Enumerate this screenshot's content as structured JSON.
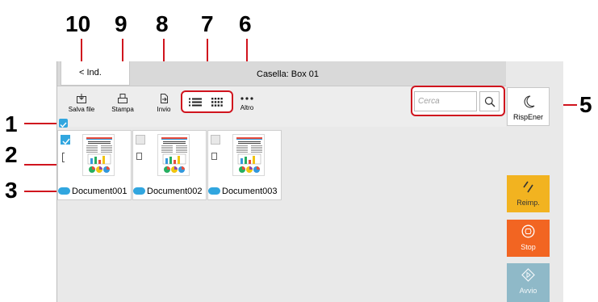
{
  "callouts": [
    "10",
    "9",
    "8",
    "7",
    "6",
    "5",
    "1",
    "2",
    "3"
  ],
  "header": {
    "back_label": "< Ind.",
    "breadcrumb": "Casella: Box 01"
  },
  "toolbar": {
    "save_label": "Salva file",
    "print_label": "Stampa",
    "send_label": "Invio",
    "more_label": "Altro"
  },
  "search": {
    "placeholder": "Cerca"
  },
  "side_buttons": {
    "energy_saver": "RispEner",
    "reprint": "Reimp.",
    "stop": "Stop",
    "start": "Avvio"
  },
  "documents": [
    {
      "name": "Document001",
      "selected": true
    },
    {
      "name": "Document002",
      "selected": false
    },
    {
      "name": "Document003",
      "selected": false
    }
  ],
  "colors": {
    "callout_red": "#d0141e",
    "select_blue": "#31a6df",
    "reprint": "#f2b320",
    "stop": "#f26522",
    "start": "#8fb9c8"
  },
  "icons": [
    "save-file-icon",
    "print-icon",
    "send-icon",
    "list-view-icon",
    "thumbnail-view-icon",
    "more-icon",
    "search-icon",
    "moon-icon",
    "reprint-icon",
    "stop-icon",
    "start-icon"
  ]
}
